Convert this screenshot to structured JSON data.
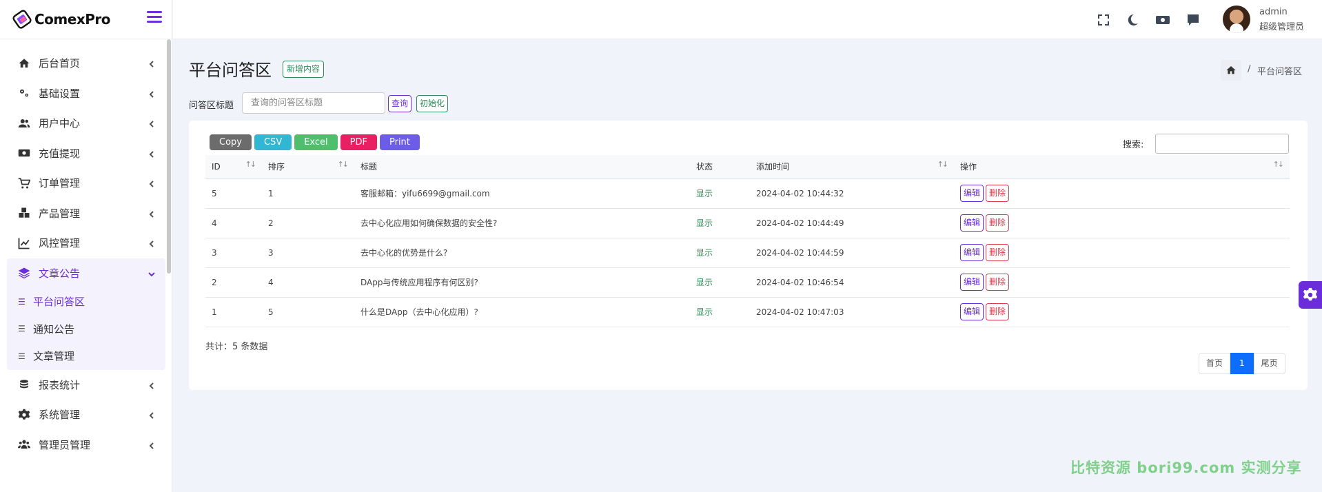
{
  "brand": {
    "name": "ComexPro"
  },
  "sidebar": {
    "items": [
      {
        "label": "后台首页",
        "icon": "home-icon"
      },
      {
        "label": "基础设置",
        "icon": "gears-icon"
      },
      {
        "label": "用户中心",
        "icon": "users-icon"
      },
      {
        "label": "充值提现",
        "icon": "money-icon"
      },
      {
        "label": "订单管理",
        "icon": "cart-icon"
      },
      {
        "label": "产品管理",
        "icon": "cubes-icon"
      },
      {
        "label": "风控管理",
        "icon": "chart-line-icon"
      },
      {
        "label": "文章公告",
        "icon": "layers-icon"
      }
    ],
    "sub_items": [
      {
        "label": "平台问答区"
      },
      {
        "label": "通知公告"
      },
      {
        "label": "文章管理"
      }
    ],
    "items_after": [
      {
        "label": "报表统计",
        "icon": "coins-icon"
      },
      {
        "label": "系统管理",
        "icon": "gear-icon"
      },
      {
        "label": "管理员管理",
        "icon": "user-group-icon"
      }
    ]
  },
  "topbar": {
    "user_name": "admin",
    "user_role": "超级管理员"
  },
  "page": {
    "title": "平台问答区",
    "add_label": "新增内容",
    "breadcrumb_sep": "/",
    "breadcrumb_current": "平台问答区"
  },
  "search": {
    "label": "问答区标题",
    "placeholder": "查询的问答区标题",
    "query_label": "查询",
    "reset_label": "初始化"
  },
  "export_buttons": [
    {
      "label": "Copy",
      "color": "#6c6c6c"
    },
    {
      "label": "CSV",
      "color": "#31b6d4"
    },
    {
      "label": "Excel",
      "color": "#4fbf6e"
    },
    {
      "label": "PDF",
      "color": "#e91e63"
    },
    {
      "label": "Print",
      "color": "#6c5ce7"
    }
  ],
  "table": {
    "search_label": "搜索:",
    "columns": [
      "ID",
      "排序",
      "标题",
      "状态",
      "添加时间",
      "操作"
    ],
    "rows": [
      {
        "id": "5",
        "sort": "1",
        "title": "客服邮箱：yifu6699@gmail.com",
        "status": "显示",
        "time": "2024-04-02 10:44:32"
      },
      {
        "id": "4",
        "sort": "2",
        "title": "去中心化应用如何确保数据的安全性?",
        "status": "显示",
        "time": "2024-04-02 10:44:49"
      },
      {
        "id": "3",
        "sort": "3",
        "title": "去中心化的优势是什么?",
        "status": "显示",
        "time": "2024-04-02 10:44:59"
      },
      {
        "id": "2",
        "sort": "4",
        "title": "DApp与传统应用程序有何区别?",
        "status": "显示",
        "time": "2024-04-02 10:46:54"
      },
      {
        "id": "1",
        "sort": "5",
        "title": "什么是DApp（去中心化应用）?",
        "status": "显示",
        "time": "2024-04-02 10:47:03"
      }
    ],
    "edit_label": "编辑",
    "delete_label": "删除",
    "total_text": "共计：5 条数据"
  },
  "pagination": {
    "first": "首页",
    "current": "1",
    "last": "尾页"
  },
  "watermark": "比特资源 bori99.com 实测分享",
  "colors": {
    "accent": "#6a2dd9",
    "success": "#2f8b57",
    "danger": "#e0384b",
    "primary": "#0d6efd"
  }
}
